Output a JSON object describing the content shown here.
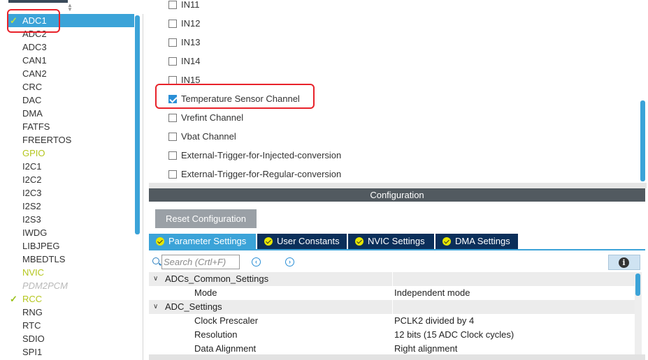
{
  "left_panel": {
    "items": [
      {
        "label": "ADC1",
        "state": "selected",
        "check": true
      },
      {
        "label": "ADC2",
        "state": "normal",
        "check": false
      },
      {
        "label": "ADC3",
        "state": "normal",
        "check": false
      },
      {
        "label": "CAN1",
        "state": "normal",
        "check": false
      },
      {
        "label": "CAN2",
        "state": "normal",
        "check": false
      },
      {
        "label": "CRC",
        "state": "normal",
        "check": false
      },
      {
        "label": "DAC",
        "state": "normal",
        "check": false
      },
      {
        "label": "DMA",
        "state": "normal",
        "check": false
      },
      {
        "label": "FATFS",
        "state": "normal",
        "check": false
      },
      {
        "label": "FREERTOS",
        "state": "normal",
        "check": false
      },
      {
        "label": "GPIO",
        "state": "warn",
        "check": false
      },
      {
        "label": "I2C1",
        "state": "normal",
        "check": false
      },
      {
        "label": "I2C2",
        "state": "normal",
        "check": false
      },
      {
        "label": "I2C3",
        "state": "normal",
        "check": false
      },
      {
        "label": "I2S2",
        "state": "normal",
        "check": false
      },
      {
        "label": "I2S3",
        "state": "normal",
        "check": false
      },
      {
        "label": "IWDG",
        "state": "normal",
        "check": false
      },
      {
        "label": "LIBJPEG",
        "state": "normal",
        "check": false
      },
      {
        "label": "MBEDTLS",
        "state": "normal",
        "check": false
      },
      {
        "label": "NVIC",
        "state": "warn",
        "check": false
      },
      {
        "label": "PDM2PCM",
        "state": "disabled",
        "check": false
      },
      {
        "label": "RCC",
        "state": "warn",
        "check": true
      },
      {
        "label": "RNG",
        "state": "normal",
        "check": false
      },
      {
        "label": "RTC",
        "state": "normal",
        "check": false
      },
      {
        "label": "SDIO",
        "state": "normal",
        "check": false
      },
      {
        "label": "SPI1",
        "state": "normal",
        "check": false
      }
    ]
  },
  "channels": [
    {
      "label": "IN11",
      "checked": false
    },
    {
      "label": "IN12",
      "checked": false
    },
    {
      "label": "IN13",
      "checked": false
    },
    {
      "label": "IN14",
      "checked": false
    },
    {
      "label": "IN15",
      "checked": false
    },
    {
      "label": "Temperature Sensor Channel",
      "checked": true
    },
    {
      "label": "Vrefint Channel",
      "checked": false
    },
    {
      "label": "Vbat Channel",
      "checked": false
    },
    {
      "label": "External-Trigger-for-Injected-conversion",
      "checked": false
    },
    {
      "label": "External-Trigger-for-Regular-conversion",
      "checked": false
    }
  ],
  "config": {
    "header": "Configuration",
    "reset_label": "Reset Configuration",
    "tabs": [
      {
        "label": "Parameter Settings",
        "active": true
      },
      {
        "label": "User Constants",
        "active": false
      },
      {
        "label": "NVIC Settings",
        "active": false
      },
      {
        "label": "DMA Settings",
        "active": false
      }
    ],
    "search_placeholder": "Search (Crtl+F)",
    "prev_glyph": "‹",
    "next_glyph": "›",
    "info_glyph": "i"
  },
  "params": [
    {
      "type": "group",
      "label": "ADCs_Common_Settings"
    },
    {
      "type": "param",
      "name": "Mode",
      "value": "Independent mode"
    },
    {
      "type": "group",
      "label": "ADC_Settings"
    },
    {
      "type": "param",
      "name": "Clock Prescaler",
      "value": "PCLK2 divided by 4"
    },
    {
      "type": "param",
      "name": "Resolution",
      "value": "12 bits (15 ADC Clock cycles)"
    },
    {
      "type": "param",
      "name": "Data Alignment",
      "value": "Right alignment"
    }
  ],
  "colors": {
    "accent": "#3ba3d8",
    "tab_dark": "#0b2f5a",
    "highlight_red": "#e8222a",
    "warn_green": "#b4c61d"
  }
}
